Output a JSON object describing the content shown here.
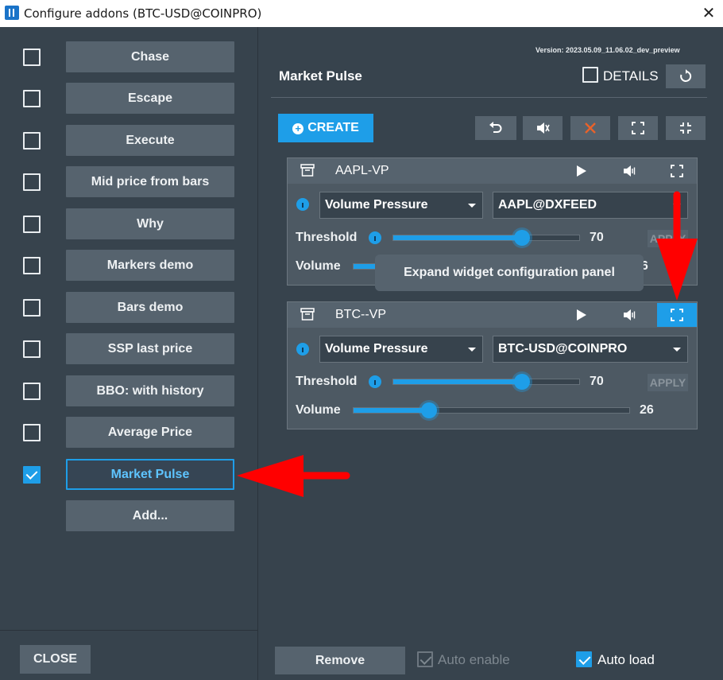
{
  "window": {
    "title": "Configure addons (BTC-USD@COINPRO)",
    "close_glyph": "✕"
  },
  "sidebar": {
    "items": [
      {
        "label": "Chase",
        "checked": false
      },
      {
        "label": "Escape",
        "checked": false
      },
      {
        "label": "Execute",
        "checked": false
      },
      {
        "label": "Mid price from bars",
        "checked": false
      },
      {
        "label": "Why",
        "checked": false
      },
      {
        "label": "Markers demo",
        "checked": false
      },
      {
        "label": "Bars demo",
        "checked": false
      },
      {
        "label": "SSP last price",
        "checked": false
      },
      {
        "label": "BBO: with history",
        "checked": false
      },
      {
        "label": "Average Price",
        "checked": false
      },
      {
        "label": "Market Pulse",
        "checked": true,
        "active": true
      }
    ],
    "add_label": "Add...",
    "close_label": "CLOSE"
  },
  "main": {
    "version": "Version: 2023.05.09_11.06.02_dev_preview",
    "title": "Market Pulse",
    "details_label": "DETAILS",
    "details_checked": false,
    "create_label": "CREATE",
    "tooltip": "Expand widget configuration panel",
    "widgets": [
      {
        "name": "AAPL-VP",
        "type": "Volume Pressure",
        "instrument": "AAPL@DXFEED",
        "threshold_label": "Threshold",
        "threshold_value": "70",
        "threshold_fraction": 0.69,
        "apply_label": "APPLY",
        "volume_label": "Volume",
        "volume_value": "26"
      },
      {
        "name": "BTC--VP",
        "type": "Volume Pressure",
        "instrument": "BTC-USD@COINPRO",
        "threshold_label": "Threshold",
        "threshold_value": "70",
        "threshold_fraction": 0.69,
        "apply_label": "APPLY",
        "volume_label": "Volume",
        "volume_value": "26",
        "volume_fraction": 0.27
      }
    ],
    "footer": {
      "remove_label": "Remove",
      "auto_enable_label": "Auto enable",
      "auto_enable_checked": true,
      "auto_enable_disabled": true,
      "auto_load_label": "Auto load",
      "auto_load_checked": true
    }
  },
  "colors": {
    "accent": "#1e9ee8",
    "background": "#37434d",
    "button": "#56636e",
    "danger": "#e8622a",
    "annotation_arrow": "#ff0000"
  }
}
